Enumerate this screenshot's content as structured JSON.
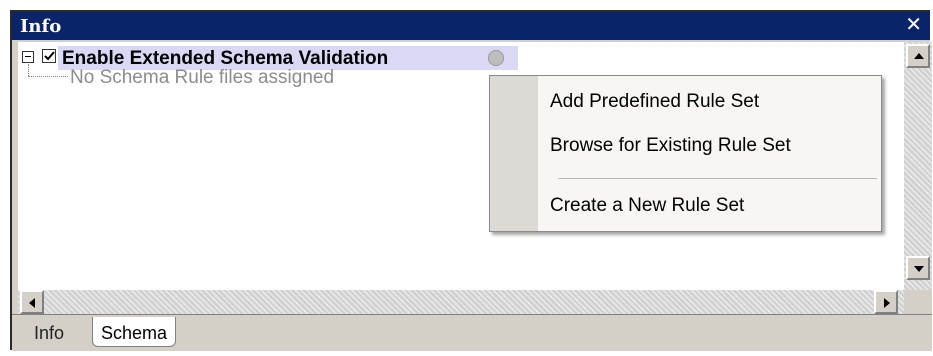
{
  "window": {
    "title": "Info",
    "close_glyph": "✕"
  },
  "tree": {
    "root_label": "Enable Extended Schema Validation",
    "root_checked": true,
    "child_label": "No Schema Rule files assigned"
  },
  "context_menu": {
    "items": [
      "Add Predefined Rule Set",
      "Browse for Existing Rule Set",
      "Create a New Rule Set"
    ]
  },
  "tabs": [
    {
      "label": "Info",
      "active": false
    },
    {
      "label": "Schema",
      "active": true
    }
  ],
  "colors": {
    "titlebar": "#0a246a",
    "highlight": "#d9d9f5",
    "menu_bg": "#f7f6f3"
  },
  "icons": [
    "collapse-icon",
    "checkbox-checked-icon",
    "rule-settings-icon",
    "close-icon"
  ]
}
